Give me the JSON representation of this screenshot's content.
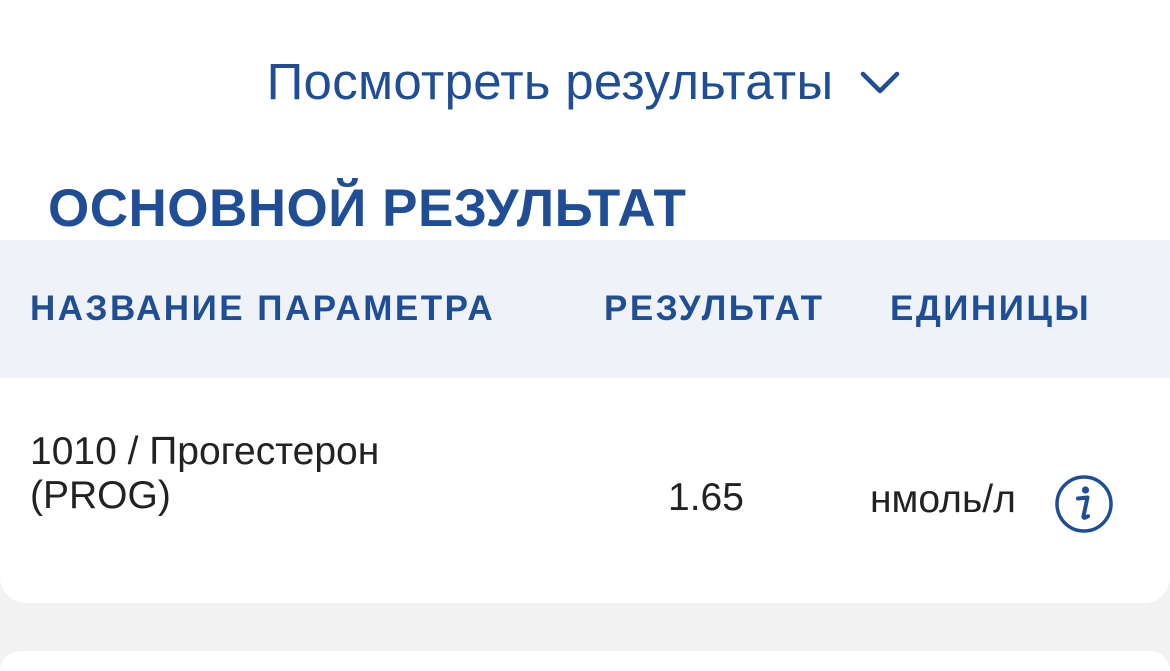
{
  "toggle": {
    "label": "Посмотреть результаты",
    "icon": "chevron-down-icon"
  },
  "section": {
    "title": "ОСНОВНОЙ РЕЗУЛЬТАТ"
  },
  "table": {
    "headers": [
      "НАЗВАНИЕ ПАРАМЕТРА",
      "РЕЗУЛЬТАТ",
      "ЕДИНИЦЫ"
    ],
    "rows": [
      {
        "name_line1": "1010 / Прогестерон",
        "name_line2": "(PROG)",
        "result": "1.65",
        "units": "нмоль/л",
        "info_icon": "info-icon"
      }
    ]
  },
  "colors": {
    "accent": "#1f4e96",
    "header_bg": "#eff2f7",
    "page_bg": "#f2f2f2",
    "text": "#222222"
  }
}
